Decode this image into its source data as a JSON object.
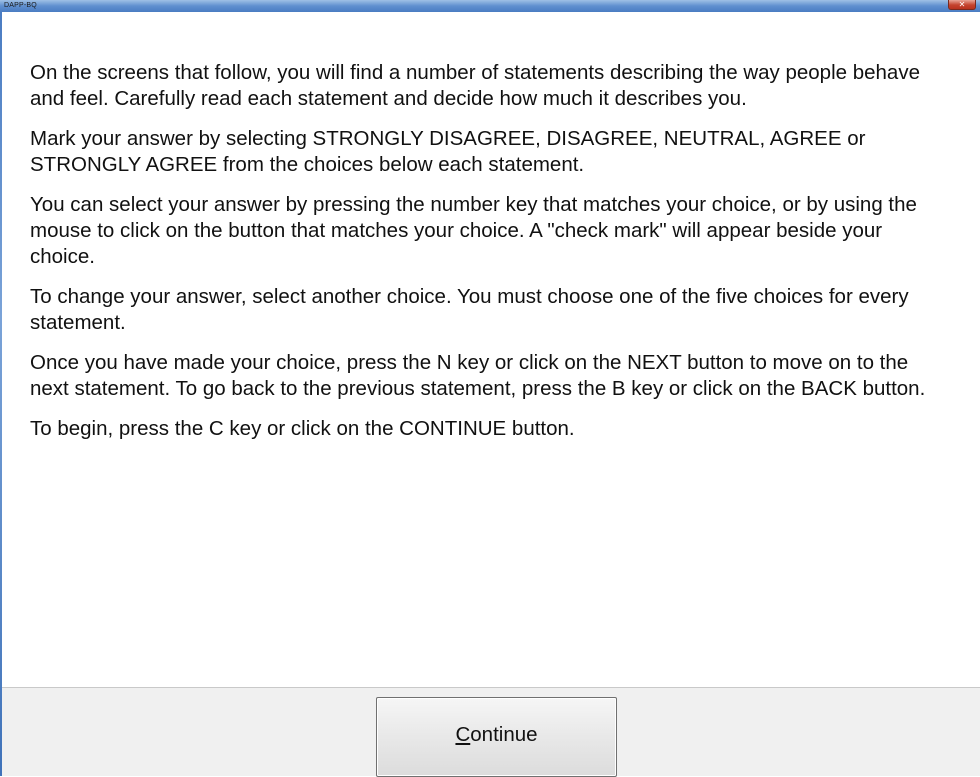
{
  "window": {
    "title": "DAPP-BQ",
    "close_glyph": "✕",
    "close_icon": "close-icon"
  },
  "instructions": {
    "paragraphs": [
      "On the screens that follow, you will find a number of statements describing the way people behave and feel. Carefully read each statement and decide how much it describes you.",
      "Mark your answer by selecting STRONGLY DISAGREE, DISAGREE, NEUTRAL, AGREE or STRONGLY AGREE from the choices below each statement.",
      "You can select your answer by pressing the number key that matches your choice, or by using the mouse to click on the button that matches your choice. A \"check mark\" will appear beside your choice.",
      "To change your answer, select another choice. You must choose one of the five choices for every statement.",
      "Once you have made your choice, press the N key or click on the NEXT button to move on to the next statement. To go back to the previous statement, press the B key or click on the BACK button.",
      "To begin, press the C key or click on the CONTINUE button."
    ]
  },
  "footer": {
    "continue_accel": "C",
    "continue_rest": "ontinue"
  },
  "colors": {
    "titlebar": "#5f8fcf",
    "close_button": "#c4432e",
    "footer_bg": "#f0f0f0",
    "text": "#111111"
  }
}
